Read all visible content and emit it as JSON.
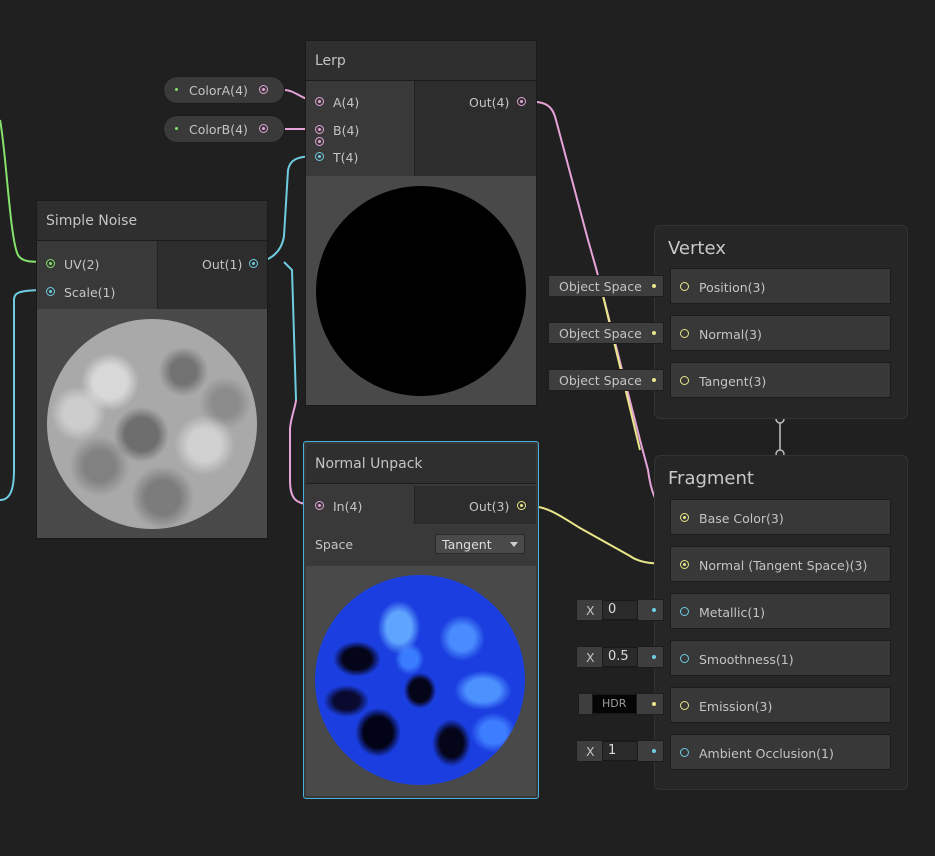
{
  "colors": {
    "green": "#84e26a",
    "pink": "#e6a3d8",
    "cyan": "#6fcde1",
    "yellow": "#e9e68a",
    "canvas": "#202020"
  },
  "lerp": {
    "title": "Lerp",
    "inputs": [
      "A(4)",
      "B(4)",
      "T(4)"
    ],
    "output": "Out(4)"
  },
  "props": [
    {
      "label": "ColorA(4)"
    },
    {
      "label": "ColorB(4)"
    }
  ],
  "noise": {
    "title": "Simple Noise",
    "inputs": [
      "UV(2)",
      "Scale(1)"
    ],
    "output": "Out(1)"
  },
  "unpack": {
    "title": "Normal Unpack",
    "input": "In(4)",
    "output": "Out(3)",
    "space_label": "Space",
    "space_value": "Tangent"
  },
  "vertex": {
    "title": "Vertex",
    "slots": [
      "Position(3)",
      "Normal(3)",
      "Tangent(3)"
    ],
    "defaults": [
      "Object Space",
      "Object Space",
      "Object Space"
    ]
  },
  "fragment": {
    "title": "Fragment",
    "slots": [
      "Base Color(3)",
      "Normal (Tangent Space)(3)",
      "Metallic(1)",
      "Smoothness(1)",
      "Emission(3)",
      "Ambient Occlusion(1)"
    ],
    "x_label": "X",
    "metallic": "0",
    "smoothness": "0.5",
    "hdr": "HDR",
    "occlusion": "1"
  }
}
